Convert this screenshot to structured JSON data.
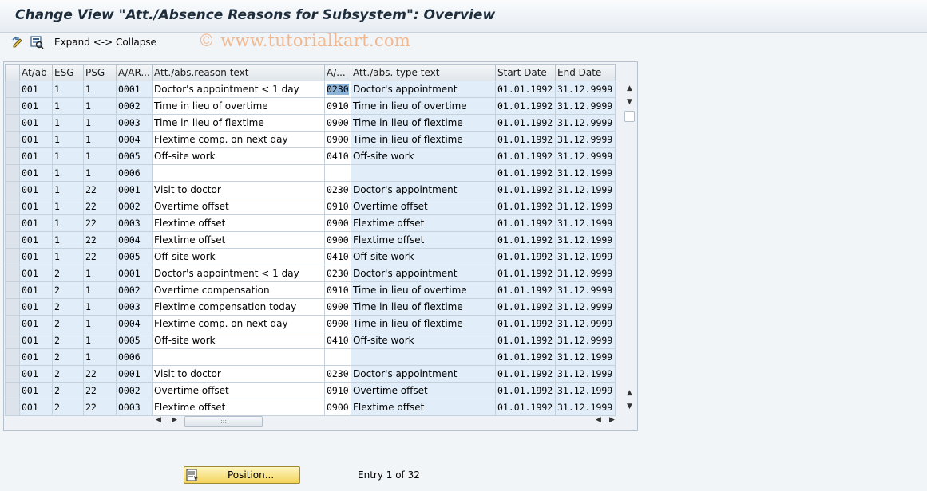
{
  "window": {
    "title": "Change View \"Att./Absence Reasons for Subsystem\": Overview"
  },
  "toolbar": {
    "expand_collapse_label": "Expand <-> Collapse"
  },
  "watermark": "© www.tutorialkart.com",
  "table": {
    "columns": [
      "At/ab",
      "ESG",
      "PSG",
      "A/AR...",
      "Att./abs.reason text",
      "A/...",
      "Att./abs. type text",
      "Start Date",
      "End Date"
    ],
    "selected_cell_value": "0230",
    "rows": [
      [
        "001",
        "1",
        "1",
        "0001",
        "Doctor's appointment < 1 day",
        "0230",
        "Doctor's appointment",
        "01.01.1992",
        "31.12.9999"
      ],
      [
        "001",
        "1",
        "1",
        "0002",
        "Time in lieu of overtime",
        "0910",
        "Time in lieu of overtime",
        "01.01.1992",
        "31.12.9999"
      ],
      [
        "001",
        "1",
        "1",
        "0003",
        "Time in lieu of flextime",
        "0900",
        "Time in lieu of flextime",
        "01.01.1992",
        "31.12.9999"
      ],
      [
        "001",
        "1",
        "1",
        "0004",
        "Flextime comp. on next day",
        "0900",
        "Time in lieu of flextime",
        "01.01.1992",
        "31.12.9999"
      ],
      [
        "001",
        "1",
        "1",
        "0005",
        "Off-site work",
        "0410",
        "Off-site work",
        "01.01.1992",
        "31.12.9999"
      ],
      [
        "001",
        "1",
        "1",
        "0006",
        "",
        "",
        "",
        "01.01.1992",
        "31.12.1999"
      ],
      [
        "001",
        "1",
        "22",
        "0001",
        "Visit to doctor",
        "0230",
        "Doctor's appointment",
        "01.01.1992",
        "31.12.1999"
      ],
      [
        "001",
        "1",
        "22",
        "0002",
        "Overtime offset",
        "0910",
        "Overtime offset",
        "01.01.1992",
        "31.12.1999"
      ],
      [
        "001",
        "1",
        "22",
        "0003",
        "Flextime offset",
        "0900",
        "Flextime offset",
        "01.01.1992",
        "31.12.1999"
      ],
      [
        "001",
        "1",
        "22",
        "0004",
        "Flextime offset",
        "0900",
        "Flextime offset",
        "01.01.1992",
        "31.12.1999"
      ],
      [
        "001",
        "1",
        "22",
        "0005",
        "Off-site work",
        "0410",
        "Off-site work",
        "01.01.1992",
        "31.12.1999"
      ],
      [
        "001",
        "2",
        "1",
        "0001",
        "Doctor's appointment < 1 day",
        "0230",
        "Doctor's appointment",
        "01.01.1992",
        "31.12.9999"
      ],
      [
        "001",
        "2",
        "1",
        "0002",
        "Overtime compensation",
        "0910",
        "Time in lieu of overtime",
        "01.01.1992",
        "31.12.9999"
      ],
      [
        "001",
        "2",
        "1",
        "0003",
        "Flextime compensation today",
        "0900",
        "Time in lieu of flextime",
        "01.01.1992",
        "31.12.9999"
      ],
      [
        "001",
        "2",
        "1",
        "0004",
        "Flextime comp. on next day",
        "0900",
        "Time in lieu of flextime",
        "01.01.1992",
        "31.12.9999"
      ],
      [
        "001",
        "2",
        "1",
        "0005",
        "Off-site work",
        "0410",
        "Off-site work",
        "01.01.1992",
        "31.12.9999"
      ],
      [
        "001",
        "2",
        "1",
        "0006",
        "",
        "",
        "",
        "01.01.1992",
        "31.12.1999"
      ],
      [
        "001",
        "2",
        "22",
        "0001",
        "Visit to doctor",
        "0230",
        "Doctor's appointment",
        "01.01.1992",
        "31.12.1999"
      ],
      [
        "001",
        "2",
        "22",
        "0002",
        "Overtime offset",
        "0910",
        "Overtime offset",
        "01.01.1992",
        "31.12.1999"
      ],
      [
        "001",
        "2",
        "22",
        "0003",
        "Flextime offset",
        "0900",
        "Flextime offset",
        "01.01.1992",
        "31.12.1999"
      ]
    ]
  },
  "footer": {
    "position_button": "Position...",
    "entry_text": "Entry 1 of 32"
  },
  "colors": {
    "key_cell_bg": "#e1eef9",
    "input_cell_bg": "#ffffff",
    "button_yellow": "#f2d35a",
    "watermark": "#f0b890"
  },
  "icons": [
    "change-display-icon",
    "select-all-icon",
    "column-settings-icon",
    "position-icon"
  ]
}
